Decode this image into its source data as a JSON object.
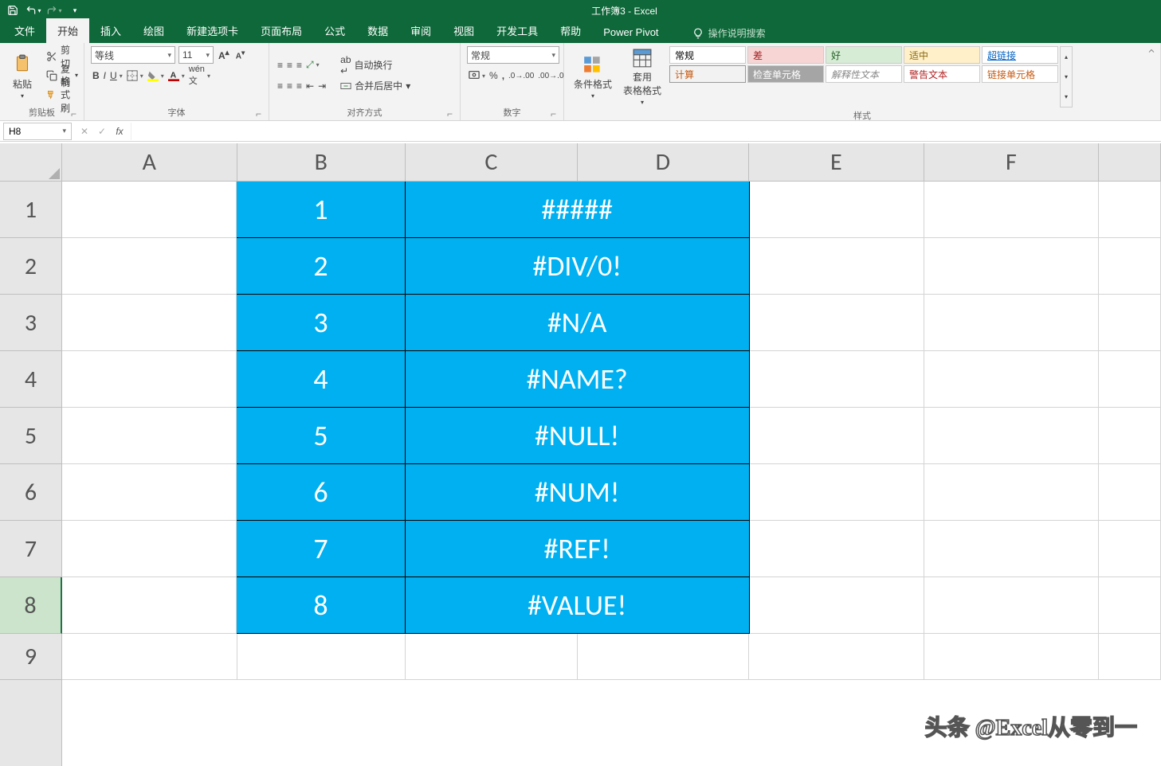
{
  "title": "工作簿3 - Excel",
  "ribbon_tabs": [
    "文件",
    "开始",
    "插入",
    "绘图",
    "新建选项卡",
    "页面布局",
    "公式",
    "数据",
    "审阅",
    "视图",
    "开发工具",
    "帮助",
    "Power Pivot"
  ],
  "active_tab": "开始",
  "tellme": "操作说明搜索",
  "clipboard": {
    "paste": "粘贴",
    "cut": "剪切",
    "copy": "复制",
    "format_painter": "格式刷",
    "label": "剪贴板"
  },
  "font": {
    "name": "等线",
    "size": "11",
    "label": "字体"
  },
  "alignment": {
    "wrap": "自动换行",
    "merge": "合并后居中",
    "label": "对齐方式"
  },
  "number": {
    "format": "常规",
    "label": "数字"
  },
  "styles": {
    "cond_fmt": "条件格式",
    "table_fmt": "套用\n表格格式",
    "gallery": {
      "normal": "常规",
      "bad": "差",
      "good": "好",
      "neutral": "适中",
      "link": "超链接",
      "calc": "计算",
      "check": "检查单元格",
      "explain": "解释性文本",
      "warn": "警告文本",
      "linked": "链接单元格"
    },
    "label": "样式"
  },
  "name_box": "H8",
  "columns": [
    "A",
    "B",
    "C",
    "D",
    "E",
    "F"
  ],
  "rows": [
    "1",
    "2",
    "3",
    "4",
    "5",
    "6",
    "7",
    "8",
    "9"
  ],
  "data": {
    "B": [
      "1",
      "2",
      "3",
      "4",
      "5",
      "6",
      "7",
      "8"
    ],
    "CD": [
      "#####",
      "#DIV/0!",
      "#N/A",
      "#NAME?",
      "#NULL!",
      "#NUM!",
      "#REF!",
      "#VALUE!"
    ]
  },
  "watermark": "头条 @Excel从零到一"
}
